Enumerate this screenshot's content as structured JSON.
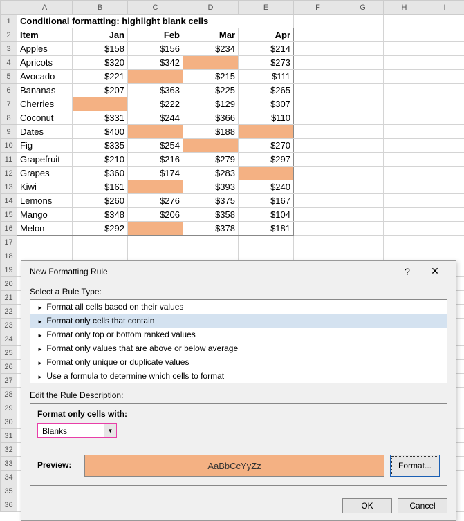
{
  "columns": [
    "A",
    "B",
    "C",
    "D",
    "E",
    "F",
    "G",
    "H",
    "I"
  ],
  "title": "Conditional formatting: highlight blank cells",
  "headers": {
    "item": "Item",
    "jan": "Jan",
    "feb": "Feb",
    "mar": "Mar",
    "apr": "Apr"
  },
  "rows": [
    {
      "item": "Apples",
      "jan": "$158",
      "feb": "$156",
      "mar": "$234",
      "apr": "$214"
    },
    {
      "item": "Apricots",
      "jan": "$320",
      "feb": "$342",
      "mar": "",
      "apr": "$273"
    },
    {
      "item": "Avocado",
      "jan": "$221",
      "feb": "",
      "mar": "$215",
      "apr": "$111"
    },
    {
      "item": "Bananas",
      "jan": "$207",
      "feb": "$363",
      "mar": "$225",
      "apr": "$265"
    },
    {
      "item": "Cherries",
      "jan": "",
      "feb": "$222",
      "mar": "$129",
      "apr": "$307"
    },
    {
      "item": "Coconut",
      "jan": "$331",
      "feb": "$244",
      "mar": "$366",
      "apr": "$110"
    },
    {
      "item": "Dates",
      "jan": "$400",
      "feb": "",
      "mar": "$188",
      "apr": ""
    },
    {
      "item": "Fig",
      "jan": "$335",
      "feb": "$254",
      "mar": "",
      "apr": "$270"
    },
    {
      "item": "Grapefruit",
      "jan": "$210",
      "feb": "$216",
      "mar": "$279",
      "apr": "$297"
    },
    {
      "item": "Grapes",
      "jan": "$360",
      "feb": "$174",
      "mar": "$283",
      "apr": ""
    },
    {
      "item": "Kiwi",
      "jan": "$161",
      "feb": "",
      "mar": "$393",
      "apr": "$240"
    },
    {
      "item": "Lemons",
      "jan": "$260",
      "feb": "$276",
      "mar": "$375",
      "apr": "$167"
    },
    {
      "item": "Mango",
      "jan": "$348",
      "feb": "$206",
      "mar": "$358",
      "apr": "$104"
    },
    {
      "item": "Melon",
      "jan": "$292",
      "feb": "",
      "mar": "$378",
      "apr": "$181"
    }
  ],
  "dialog": {
    "title": "New Formatting Rule",
    "select_label": "Select a Rule Type:",
    "rule_types": [
      "Format all cells based on their values",
      "Format only cells that contain",
      "Format only top or bottom ranked values",
      "Format only values that are above or below average",
      "Format only unique or duplicate values",
      "Use a formula to determine which cells to format"
    ],
    "selected_rule_index": 1,
    "edit_label": "Edit the Rule Description:",
    "format_with_label": "Format only cells with:",
    "condition_value": "Blanks",
    "preview_label": "Preview:",
    "preview_text": "AaBbCcYyZz",
    "format_button": "Format...",
    "ok": "OK",
    "cancel": "Cancel"
  }
}
